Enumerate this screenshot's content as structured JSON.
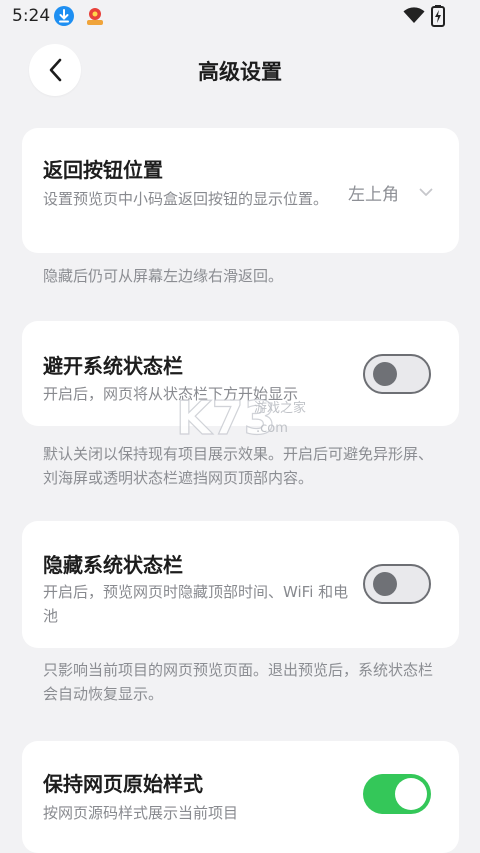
{
  "status_bar": {
    "time": "5:24"
  },
  "header": {
    "title": "高级设置"
  },
  "settings": [
    {
      "title": "返回按钮位置",
      "desc": "设置预览页中小码盒返回按钮的显示位置。",
      "value": "左上角",
      "hint": "隐藏后仍可从屏幕左边缘右滑返回。"
    },
    {
      "title": "避开系统状态栏",
      "desc": "开启后，网页将从状态栏下方开始显示",
      "toggle_on": false,
      "hint": "默认关闭以保持现有项目展示效果。开启后可避免异形屏、刘海屏或透明状态栏遮挡网页顶部内容。"
    },
    {
      "title": "隐藏系统状态栏",
      "desc": "开启后，预览网页时隐藏顶部时间、WiFi 和电池",
      "toggle_on": false,
      "hint": "只影响当前项目的网页预览页面。退出预览后，系统状态栏会自动恢复显示。"
    },
    {
      "title": "保持网页原始样式",
      "desc": "按网页源码样式展示当前项目",
      "toggle_on": true
    }
  ],
  "watermark": {
    "brand": "K73",
    "subtitle": "游戏之家",
    "domain": ".com"
  },
  "colors": {
    "accent_on": "#34c759",
    "background": "#f2f2f4",
    "card": "#ffffff"
  }
}
